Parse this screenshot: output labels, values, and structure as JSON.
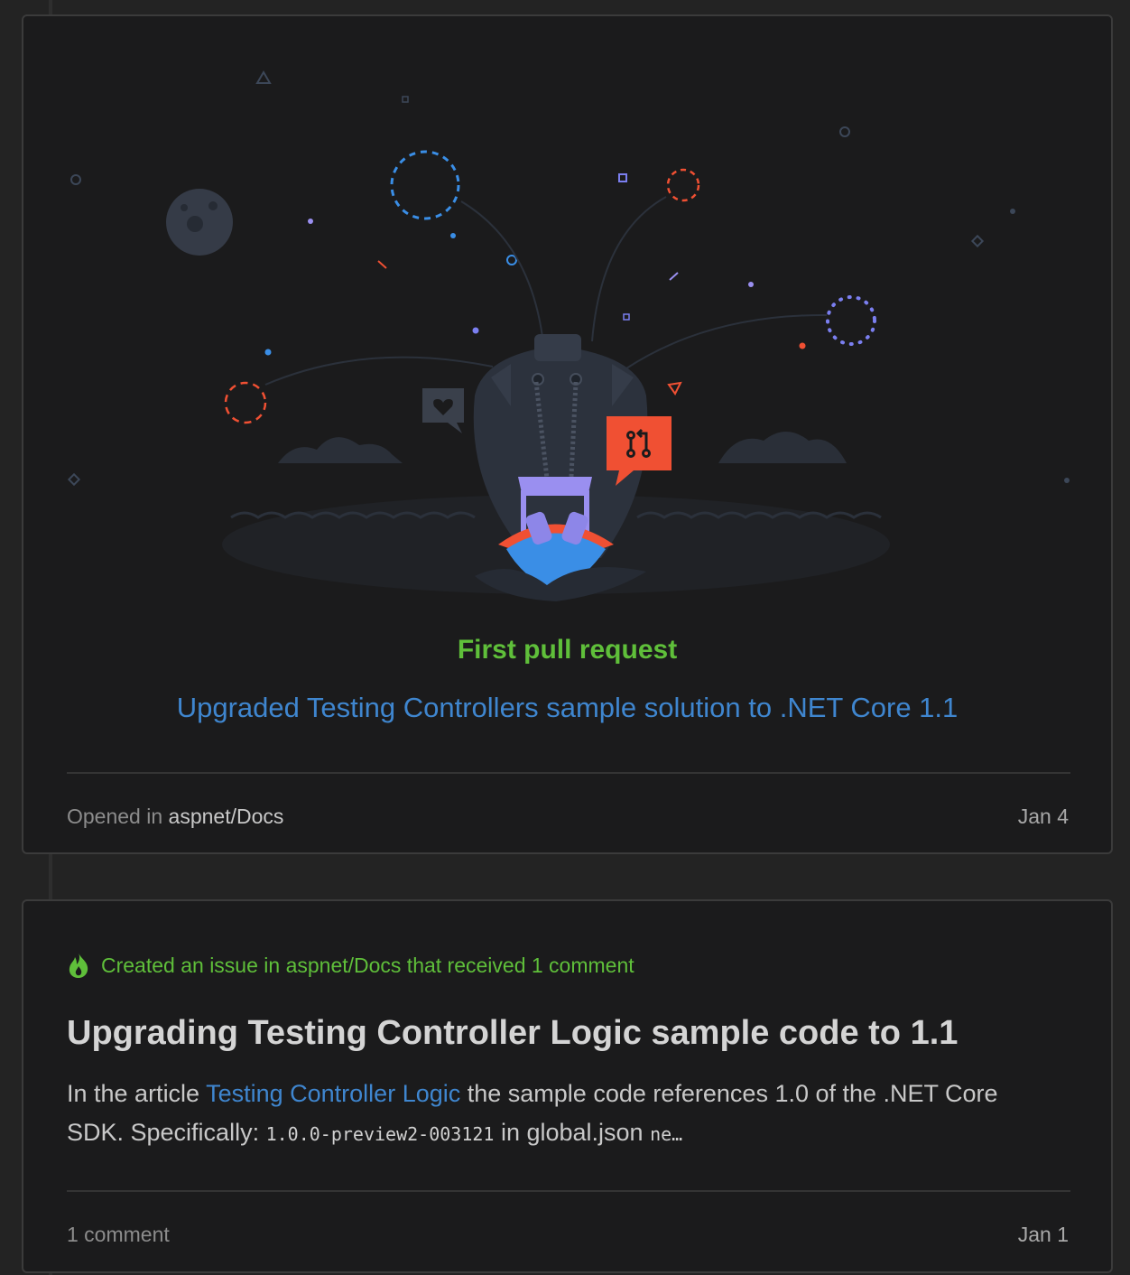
{
  "card_pr": {
    "milestone_title": "First pull request",
    "pr_title": "Upgraded Testing Controllers sample solution to .NET Core 1.1",
    "footer_prefix": "Opened in",
    "repo": "aspnet/Docs",
    "date": "Jan 4"
  },
  "card_issue": {
    "header": "Created an issue in aspnet/Docs that received 1 comment",
    "title": "Upgrading Testing Controller Logic sample code to 1.1",
    "body_part1": "In the article ",
    "body_link": "Testing Controller Logic",
    "body_part2": " the sample code references 1.0 of the .NET Core SDK. Specifically: ",
    "body_code1": "1.0.0-preview2-003121",
    "body_part3": " in global.json ",
    "body_code2": "ne…",
    "footer_comments": "1 comment",
    "date": "Jan 1"
  },
  "colors": {
    "accent_green": "#5fbf3a",
    "link_blue": "#3f86cf",
    "pr_badge_red": "#f05033",
    "boat_purple": "#9a8ff0"
  },
  "icons": {
    "header_icon": "flame-icon",
    "pr_badge_icon": "git-pull-request-icon",
    "heart_icon": "heart-icon"
  }
}
